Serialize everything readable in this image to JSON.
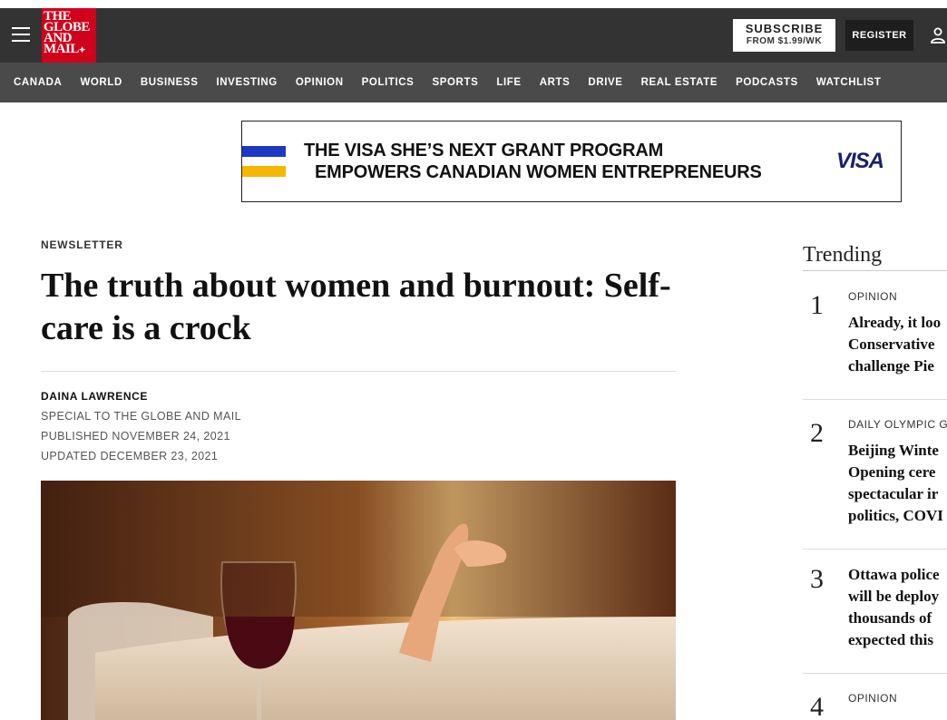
{
  "header": {
    "logo_lines": [
      "THE",
      "GLOBE",
      "AND",
      "MAIL"
    ],
    "subscribe_label": "SUBSCRIBE",
    "subscribe_price": "FROM $1.99/WK",
    "register_label": "REGISTER"
  },
  "nav": {
    "items": [
      "CANADA",
      "WORLD",
      "BUSINESS",
      "INVESTING",
      "OPINION",
      "POLITICS",
      "SPORTS",
      "LIFE",
      "ARTS",
      "DRIVE",
      "REAL ESTATE",
      "PODCASTS",
      "WATCHLIST"
    ]
  },
  "ad": {
    "line1": "THE VISA SHE’S NEXT GRANT PROGRAM",
    "line2": "EMPOWERS CANADIAN WOMEN ENTREPRENEURS",
    "brand": "VISA",
    "colors": {
      "blue": "#1d39c4",
      "yellow": "#f7b600",
      "brand": "#1a1f71"
    }
  },
  "article": {
    "kicker": "NEWSLETTER",
    "headline": "The truth about women and burnout: Self-care is a crock",
    "author": "DAINA LAWRENCE",
    "source": "SPECIAL TO THE GLOBE AND MAIL",
    "published": "PUBLISHED NOVEMBER 24, 2021",
    "updated": "UPDATED DECEMBER 23, 2021"
  },
  "trending": {
    "title": "Trending",
    "items": [
      {
        "num": "1",
        "label": "OPINION",
        "title_lines": [
          "Already, it loo",
          "Conservative",
          "challenge Pie"
        ]
      },
      {
        "num": "2",
        "label": "DAILY OLYMPIC G",
        "title_lines": [
          "Beijing Winte",
          "Opening cere",
          "spectacular ir",
          "politics, COVI"
        ]
      },
      {
        "num": "3",
        "label": "",
        "title_lines": [
          "Ottawa police",
          "will be deploy",
          "thousands of",
          "expected this"
        ]
      },
      {
        "num": "4",
        "label": "OPINION",
        "title_lines": []
      }
    ]
  },
  "colors": {
    "topbar": "#333333",
    "nav": "#4a4a4a",
    "logo_red": "#d0021b"
  }
}
